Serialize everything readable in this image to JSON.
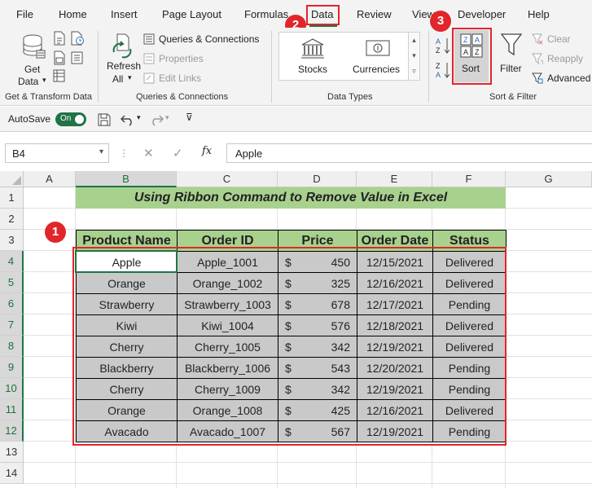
{
  "menu": [
    "File",
    "Home",
    "Insert",
    "Page Layout",
    "Formulas",
    "Data",
    "Review",
    "View",
    "Developer",
    "Help"
  ],
  "ribbon": {
    "get_data": {
      "line1": "Get",
      "line2": "Data"
    },
    "get_transform_label": "Get & Transform Data",
    "refresh": {
      "line1": "Refresh",
      "line2": "All"
    },
    "queries": [
      "Queries & Connections",
      "Properties",
      "Edit Links"
    ],
    "queries_label": "Queries & Connections",
    "stocks": "Stocks",
    "currencies": "Currencies",
    "data_types_label": "Data Types",
    "sort": "Sort",
    "filter": "Filter",
    "clear": "Clear",
    "reapply": "Reapply",
    "advanced": "Advanced",
    "sort_filter_label": "Sort & Filter"
  },
  "qat": {
    "autosave": "AutoSave",
    "toggle": "On"
  },
  "formula_bar": {
    "name_box": "B4",
    "fx": "fx",
    "value": "Apple"
  },
  "columns": [
    "A",
    "B",
    "C",
    "D",
    "E",
    "F",
    "G"
  ],
  "rows": [
    "1",
    "2",
    "3",
    "4",
    "5",
    "6",
    "7",
    "8",
    "9",
    "10",
    "11",
    "12",
    "13",
    "14"
  ],
  "sheet": {
    "title": "Using Ribbon Command to Remove Value in Excel",
    "headers": [
      "Product Name",
      "Order ID",
      "Price",
      "Order Date",
      "Status"
    ],
    "currency_symbol": "$",
    "data": [
      [
        "Apple",
        "Apple_1001",
        "450",
        "12/15/2021",
        "Delivered"
      ],
      [
        "Orange",
        "Orange_1002",
        "325",
        "12/16/2021",
        "Delivered"
      ],
      [
        "Strawberry",
        "Strawberry_1003",
        "678",
        "12/17/2021",
        "Pending"
      ],
      [
        "Kiwi",
        "Kiwi_1004",
        "576",
        "12/18/2021",
        "Delivered"
      ],
      [
        "Cherry",
        "Cherry_1005",
        "342",
        "12/19/2021",
        "Delivered"
      ],
      [
        "Blackberry",
        "Blackberry_1006",
        "543",
        "12/20/2021",
        "Pending"
      ],
      [
        "Cherry",
        "Cherry_1009",
        "342",
        "12/19/2021",
        "Pending"
      ],
      [
        "Orange",
        "Orange_1008",
        "425",
        "12/16/2021",
        "Delivered"
      ],
      [
        "Avacado",
        "Avacado_1007",
        "567",
        "12/19/2021",
        "Pending"
      ]
    ]
  },
  "badges": [
    "1",
    "2",
    "3"
  ],
  "colors": {
    "accent_green": "#217346",
    "header_green": "#a9d18e",
    "data_gray": "#c9c9c9",
    "callout_red": "#e0262b"
  }
}
